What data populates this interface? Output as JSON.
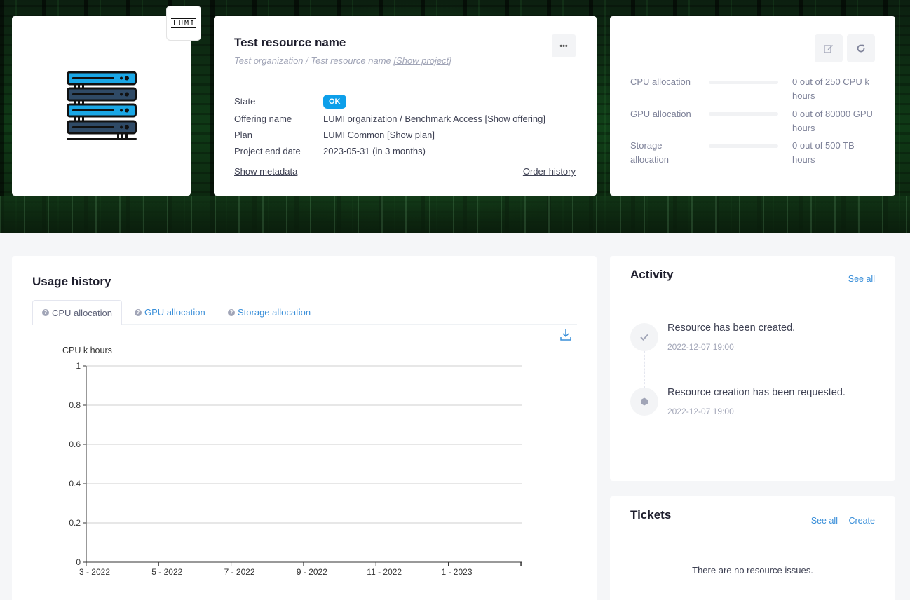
{
  "logo": {
    "text": "LUMI"
  },
  "resource": {
    "title": "Test resource name",
    "breadcrumb": "Test organization / Test resource name",
    "show_project_link": "[Show project]",
    "more_button": "•••",
    "state_label": "State",
    "state_value": "OK",
    "offering_label": "Offering name",
    "offering_value": "LUMI organization / Benchmark Access",
    "show_offering_link": "[Show offering]",
    "plan_label": "Plan",
    "plan_value": "LUMI Common",
    "show_plan_link": "[Show plan]",
    "end_date_label": "Project end date",
    "end_date_value": "2023-05-31 (in 3 months)",
    "show_metadata_link": "Show metadata",
    "order_history_link": "Order history",
    "state_color": "#0d9fea"
  },
  "quotas": [
    {
      "label": "CPU allocation",
      "value": "0 out of 250 CPU k hours",
      "usage": 0
    },
    {
      "label": "GPU allocation",
      "value": "0 out of 80000 GPU hours",
      "usage": 0
    },
    {
      "label": "Storage allocation",
      "value": "0 out of 500 TB-hours",
      "usage": 0
    }
  ],
  "quota_actions": {
    "edit_icon": "edit-icon",
    "refresh_icon": "refresh-icon"
  },
  "usage": {
    "title": "Usage history",
    "tabs": [
      {
        "label": "CPU allocation",
        "active": true
      },
      {
        "label": "GPU allocation",
        "active": false
      },
      {
        "label": "Storage allocation",
        "active": false
      }
    ]
  },
  "chart_data": {
    "type": "line",
    "ylabel": "CPU k hours",
    "xlabel": "",
    "ylim": [
      0,
      1
    ],
    "yticks": [
      0,
      0.2,
      0.4,
      0.6,
      0.8,
      1
    ],
    "categories": [
      "3 - 2022",
      "5 - 2022",
      "7 - 2022",
      "9 - 2022",
      "11 - 2022",
      "1 - 2023"
    ],
    "series": [
      {
        "values": []
      }
    ],
    "grid": true
  },
  "activity": {
    "title": "Activity",
    "see_all": "See all",
    "events": [
      {
        "text": "Resource has been created.",
        "time": "2022-12-07 19:00",
        "icon": "check-icon"
      },
      {
        "text": "Resource creation has been requested.",
        "time": "2022-12-07 19:00",
        "icon": "cube-icon"
      }
    ]
  },
  "tickets": {
    "title": "Tickets",
    "see_all": "See all",
    "create": "Create",
    "empty_text": "There are no resource issues."
  },
  "colors": {
    "accent": "#3a8fd9",
    "badge_ok": "#0d9fea",
    "server_blue": "#1aa7e6",
    "server_dark": "#2f4a66"
  }
}
